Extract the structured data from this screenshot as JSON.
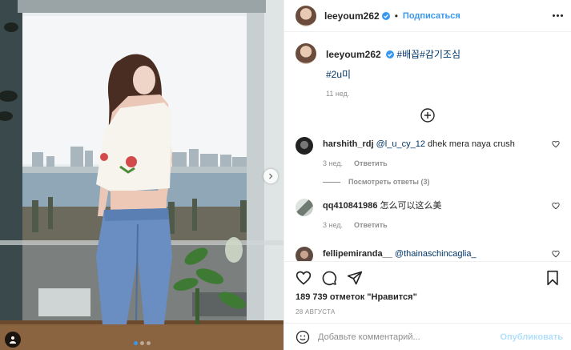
{
  "author": {
    "username": "leeyoum262",
    "verified": true,
    "follow_label": "Подписаться",
    "separator": "•"
  },
  "caption": {
    "username": "leeyoum262",
    "hashtags_line": "#배꼽#감기조심",
    "second_line": "#2u미",
    "time_ago": "11 нед."
  },
  "comments": [
    {
      "username": "harshith_rdj",
      "mention": "@l_u_cy_12",
      "text": " dhek mera naya crush",
      "time_ago": "3 нед.",
      "reply_label": "Ответить",
      "view_replies": "Посмотреть ответы (3)"
    },
    {
      "username": "qq410841986",
      "mention": "",
      "text": " 怎么可以这么美",
      "time_ago": "3 нед.",
      "reply_label": "Ответить"
    },
    {
      "username": "fellipemiranda__",
      "mention": "@thainaschincaglia_",
      "text": ""
    }
  ],
  "engagement": {
    "likes_text": "189 739 отметок \"Нравится\"",
    "date": "28 АВГУСТА"
  },
  "comment_box": {
    "placeholder": "Добавьте комментарий...",
    "publish_label": "Опубликовать"
  },
  "icons": {
    "header_more": "more-options-icon",
    "verified": "verified-badge-icon",
    "load_more": "plus-circle-icon",
    "like": "heart-icon",
    "comment": "comment-icon",
    "share": "paper-plane-icon",
    "save": "bookmark-icon",
    "emoji": "smiley-icon",
    "tags": "person-tag-icon",
    "next": "chevron-right-icon"
  },
  "colors": {
    "link_blue": "#3897f0",
    "hashtag_blue": "#003569",
    "muted": "#8e8e8e",
    "publish_disabled": "#b2dffc"
  }
}
